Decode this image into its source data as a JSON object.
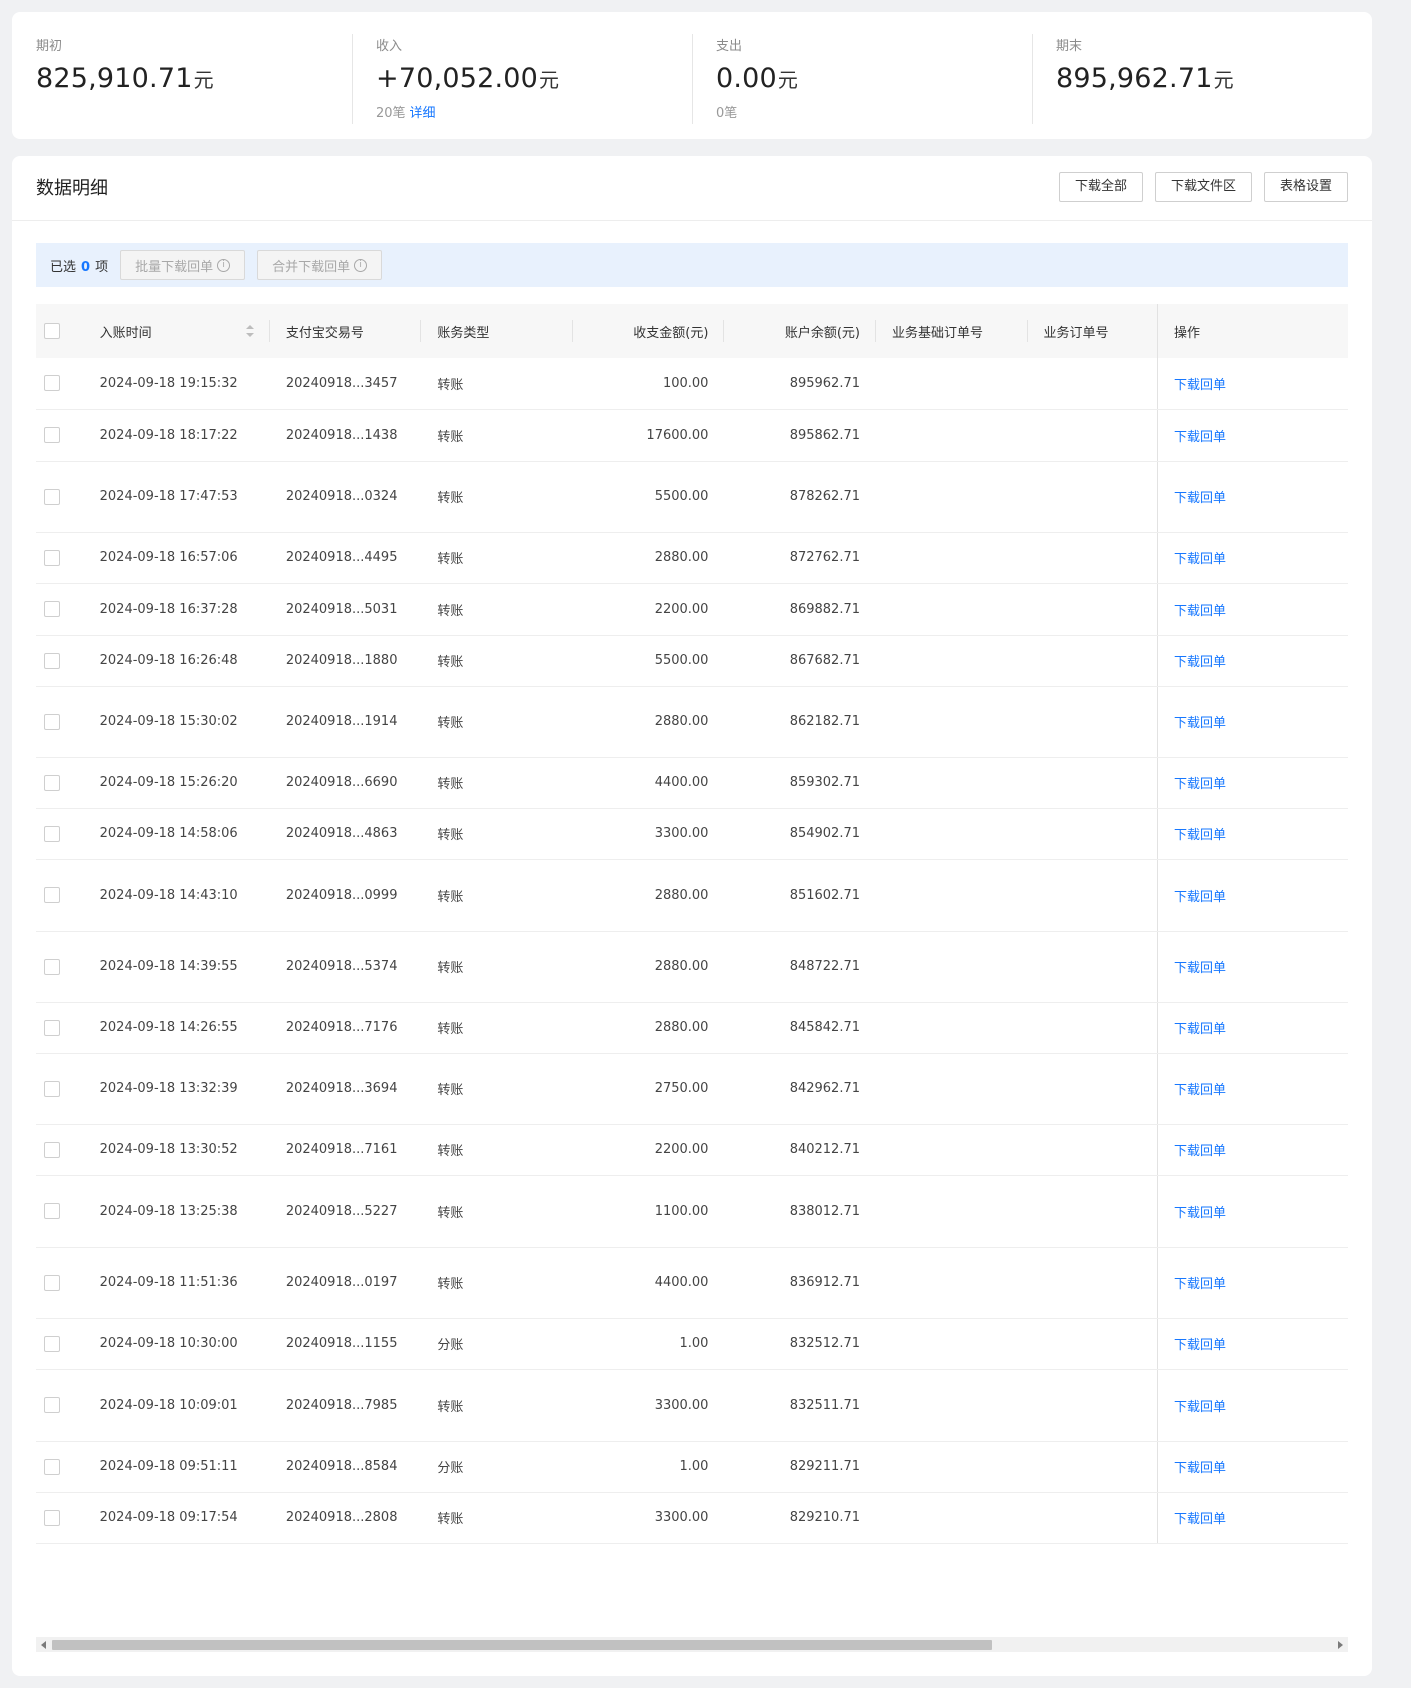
{
  "summary": [
    {
      "label": "期初",
      "value": "825,910.71",
      "unit": "元",
      "sub_count": "",
      "sub_link": ""
    },
    {
      "label": "收入",
      "value": "+70,052.00",
      "unit": "元",
      "sub_count": "20笔",
      "sub_link": "详细"
    },
    {
      "label": "支出",
      "value": "0.00",
      "unit": "元",
      "sub_count": "0笔",
      "sub_link": ""
    },
    {
      "label": "期末",
      "value": "895,962.71",
      "unit": "元",
      "sub_count": "",
      "sub_link": ""
    }
  ],
  "panel": {
    "title": "数据明细",
    "buttons": [
      "下载全部",
      "下载文件区",
      "表格设置"
    ]
  },
  "selection": {
    "prefix": "已选",
    "count": "0",
    "suffix": "项",
    "batch_download": "批量下载回单",
    "merge_download": "合并下载回单"
  },
  "table": {
    "columns": [
      "入账时间",
      "支付宝交易号",
      "账务类型",
      "收支金额(元)",
      "账户余额(元)",
      "业务基础订单号",
      "业务订单号",
      "操作"
    ],
    "action_label": "下载回单",
    "rows": [
      {
        "time": "2024-09-18 19:15:32",
        "txn": "20240918...3457",
        "type": "转账",
        "amount": "100.00",
        "balance": "895962.71"
      },
      {
        "time": "2024-09-18 18:17:22",
        "txn": "20240918...1438",
        "type": "转账",
        "amount": "17600.00",
        "balance": "895862.71"
      },
      {
        "time": "2024-09-18 17:47:53",
        "txn": "20240918...0324",
        "type": "转账",
        "amount": "5500.00",
        "balance": "878262.71"
      },
      {
        "time": "2024-09-18 16:57:06",
        "txn": "20240918...4495",
        "type": "转账",
        "amount": "2880.00",
        "balance": "872762.71"
      },
      {
        "time": "2024-09-18 16:37:28",
        "txn": "20240918...5031",
        "type": "转账",
        "amount": "2200.00",
        "balance": "869882.71"
      },
      {
        "time": "2024-09-18 16:26:48",
        "txn": "20240918...1880",
        "type": "转账",
        "amount": "5500.00",
        "balance": "867682.71"
      },
      {
        "time": "2024-09-18 15:30:02",
        "txn": "20240918...1914",
        "type": "转账",
        "amount": "2880.00",
        "balance": "862182.71"
      },
      {
        "time": "2024-09-18 15:26:20",
        "txn": "20240918...6690",
        "type": "转账",
        "amount": "4400.00",
        "balance": "859302.71"
      },
      {
        "time": "2024-09-18 14:58:06",
        "txn": "20240918...4863",
        "type": "转账",
        "amount": "3300.00",
        "balance": "854902.71"
      },
      {
        "time": "2024-09-18 14:43:10",
        "txn": "20240918...0999",
        "type": "转账",
        "amount": "2880.00",
        "balance": "851602.71"
      },
      {
        "time": "2024-09-18 14:39:55",
        "txn": "20240918...5374",
        "type": "转账",
        "amount": "2880.00",
        "balance": "848722.71"
      },
      {
        "time": "2024-09-18 14:26:55",
        "txn": "20240918...7176",
        "type": "转账",
        "amount": "2880.00",
        "balance": "845842.71"
      },
      {
        "time": "2024-09-18 13:32:39",
        "txn": "20240918...3694",
        "type": "转账",
        "amount": "2750.00",
        "balance": "842962.71"
      },
      {
        "time": "2024-09-18 13:30:52",
        "txn": "20240918...7161",
        "type": "转账",
        "amount": "2200.00",
        "balance": "840212.71"
      },
      {
        "time": "2024-09-18 13:25:38",
        "txn": "20240918...5227",
        "type": "转账",
        "amount": "1100.00",
        "balance": "838012.71"
      },
      {
        "time": "2024-09-18 11:51:36",
        "txn": "20240918...0197",
        "type": "转账",
        "amount": "4400.00",
        "balance": "836912.71"
      },
      {
        "time": "2024-09-18 10:30:00",
        "txn": "20240918...1155",
        "type": "分账",
        "amount": "1.00",
        "balance": "832512.71"
      },
      {
        "time": "2024-09-18 10:09:01",
        "txn": "20240918...7985",
        "type": "转账",
        "amount": "3300.00",
        "balance": "832511.71"
      },
      {
        "time": "2024-09-18 09:51:11",
        "txn": "20240918...8584",
        "type": "分账",
        "amount": "1.00",
        "balance": "829211.71"
      },
      {
        "time": "2024-09-18 09:17:54",
        "txn": "20240918...2808",
        "type": "转账",
        "amount": "3300.00",
        "balance": "829210.71"
      }
    ]
  }
}
